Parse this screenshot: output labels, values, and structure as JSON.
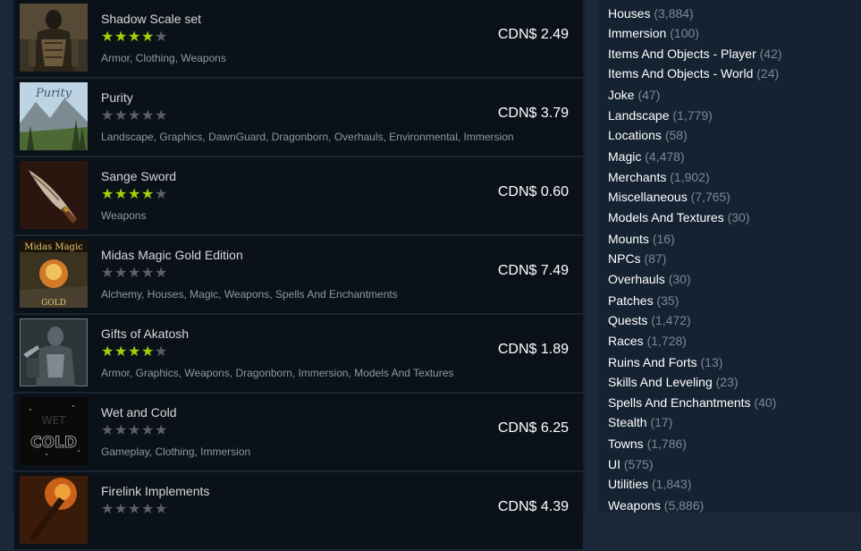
{
  "colors": {
    "star_on": "#a4d007",
    "star_off": "#5b6067",
    "background": "#1b2838"
  },
  "items": [
    {
      "title": "Shadow Scale set",
      "rating": 4,
      "tags": "Armor, Clothing, Weapons",
      "price": "CDN$ 2.49",
      "thumb_icon": "armored-figure-thumbnail"
    },
    {
      "title": "Purity",
      "rating": 0,
      "tags": "Landscape, Graphics, DawnGuard, Dragonborn, Overhauls, Environmental, Immersion",
      "price": "CDN$ 3.79",
      "thumb_icon": "landscape-thumbnail",
      "thumb_text": "Purity"
    },
    {
      "title": "Sange Sword",
      "rating": 4,
      "tags": "Weapons",
      "price": "CDN$ 0.60",
      "thumb_icon": "sword-thumbnail"
    },
    {
      "title": "Midas Magic Gold Edition",
      "rating": 0,
      "tags": "Alchemy, Houses, Magic, Weapons, Spells And Enchantments",
      "price": "CDN$ 7.49",
      "thumb_icon": "midas-magic-thumbnail",
      "thumb_text": "Midas Magic",
      "thumb_subtext": "GOLD"
    },
    {
      "title": "Gifts of Akatosh",
      "rating": 4,
      "tags": "Armor, Graphics, Weapons, Dragonborn, Immersion, Models And Textures",
      "price": "CDN$ 1.89",
      "thumb_icon": "armored-knight-thumbnail"
    },
    {
      "title": "Wet and Cold",
      "rating": 0,
      "tags": "Gameplay, Clothing, Immersion",
      "price": "CDN$ 6.25",
      "thumb_icon": "wet-and-cold-thumbnail",
      "thumb_text": "WET",
      "thumb_subtext": "COLD"
    },
    {
      "title": "Firelink Implements",
      "rating": 0,
      "tags": "",
      "price": "CDN$ 4.39",
      "thumb_icon": "fire-weapon-thumbnail"
    }
  ],
  "categories": [
    {
      "name": "Houses",
      "count": "(3,884)"
    },
    {
      "name": "Immersion",
      "count": "(100)"
    },
    {
      "name": "Items And Objects - Player",
      "count": "(42)"
    },
    {
      "name": "Items And Objects - World",
      "count": "(24)"
    },
    {
      "name": "Joke",
      "count": "(47)"
    },
    {
      "name": "Landscape",
      "count": "(1,779)"
    },
    {
      "name": "Locations",
      "count": "(58)"
    },
    {
      "name": "Magic",
      "count": "(4,478)"
    },
    {
      "name": "Merchants",
      "count": "(1,902)"
    },
    {
      "name": "Miscellaneous",
      "count": "(7,765)"
    },
    {
      "name": "Models And Textures",
      "count": "(30)"
    },
    {
      "name": "Mounts",
      "count": "(16)"
    },
    {
      "name": "NPCs",
      "count": "(87)"
    },
    {
      "name": "Overhauls",
      "count": "(30)"
    },
    {
      "name": "Patches",
      "count": "(35)"
    },
    {
      "name": "Quests",
      "count": "(1,472)"
    },
    {
      "name": "Races",
      "count": "(1,728)"
    },
    {
      "name": "Ruins And Forts",
      "count": "(13)"
    },
    {
      "name": "Skills And Leveling",
      "count": "(23)"
    },
    {
      "name": "Spells And Enchantments",
      "count": "(40)"
    },
    {
      "name": "Stealth",
      "count": "(17)"
    },
    {
      "name": "Towns",
      "count": "(1,786)"
    },
    {
      "name": "UI",
      "count": "(575)"
    },
    {
      "name": "Utilities",
      "count": "(1,843)"
    },
    {
      "name": "Weapons",
      "count": "(5,886)"
    }
  ]
}
